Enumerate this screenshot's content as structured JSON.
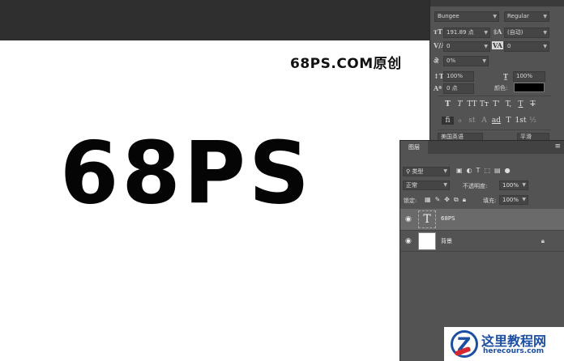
{
  "canvas": {
    "watermark": "68PS.COM原创",
    "main_text": "68PS"
  },
  "character_panel": {
    "font_family": "Bungee",
    "font_style": "Regular",
    "font_size": "191.89 点",
    "leading": "(自动)",
    "kerning": "0",
    "tracking": "0",
    "scale_percent": "0%",
    "vertical_scale": "100%",
    "horizontal_scale": "100%",
    "baseline_shift": "0 点",
    "color_label": "颜色:",
    "color_value": "#000000",
    "language": "美国英语",
    "antialias": "平滑",
    "type_buttons": [
      "T",
      "T",
      "TT",
      "Tт",
      "T'",
      "T,",
      "T",
      "T"
    ],
    "opentype_buttons": [
      "fi",
      "ℴ",
      "st",
      "A",
      "ad",
      "T",
      "1st",
      "½"
    ]
  },
  "layers_panel": {
    "tab_label": "图层",
    "filter_kind": "类型",
    "blend_mode": "正常",
    "opacity_label": "不透明度:",
    "opacity_value": "100%",
    "lock_label": "锁定:",
    "fill_label": "填充:",
    "fill_value": "100%",
    "layers": [
      {
        "name": "68PS",
        "type": "text",
        "selected": true
      },
      {
        "name": "背景",
        "type": "background",
        "locked": true
      }
    ]
  },
  "logo": {
    "chinese": "这里教程网",
    "url": "herecours.com"
  }
}
